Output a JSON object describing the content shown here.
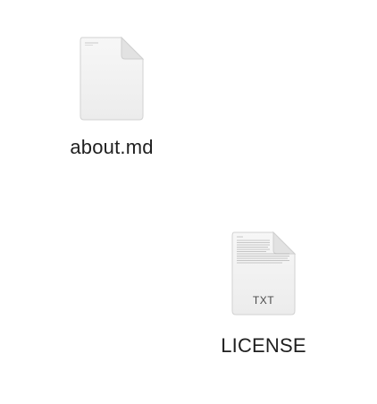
{
  "desktop": {
    "files": [
      {
        "name": "about.md",
        "icon": "document-icon",
        "badge": ""
      },
      {
        "name": "LICENSE",
        "icon": "text-document-icon",
        "badge": "TXT"
      }
    ]
  }
}
